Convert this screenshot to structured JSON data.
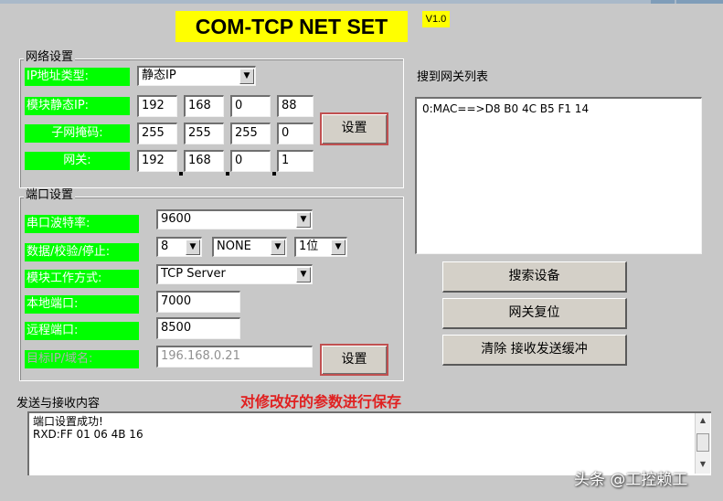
{
  "header": {
    "title": "COM-TCP NET SET",
    "version": "V1.0"
  },
  "network": {
    "group_label": "网络设置",
    "ip_type_label": "IP地址类型:",
    "ip_type_value": "静态IP",
    "static_ip_label": "模块静态IP:",
    "static_ip": [
      "192",
      "168",
      "0",
      "88"
    ],
    "subnet_label": "子网掩码:",
    "subnet": [
      "255",
      "255",
      "255",
      "0"
    ],
    "gateway_label": "网关:",
    "gateway": [
      "192",
      "168",
      "0",
      "1"
    ],
    "set_button": "设置"
  },
  "port": {
    "group_label": "端口设置",
    "baud_label": "串口波特率:",
    "baud_value": "9600",
    "data_label": "数据/校验/停止:",
    "data_bits": "8",
    "parity": "NONE",
    "stop_bits": "1位",
    "mode_label": "模块工作方式:",
    "mode_value": "TCP Server",
    "local_port_label": "本地端口:",
    "local_port": "7000",
    "remote_port_label": "远程端口:",
    "remote_port": "8500",
    "target_label": "目标IP/域名:",
    "target_value": "196.168.0.21",
    "set_button": "设置"
  },
  "gateway_list": {
    "label": "搜到网关列表",
    "items": [
      "0:MAC==>D8 B0 4C B5 F1 14"
    ]
  },
  "actions": {
    "search": "搜索设备",
    "reset": "网关复位",
    "clear": "清除 接收发送缓冲"
  },
  "log": {
    "label": "发送与接收内容",
    "annotation": "对修改好的参数进行保存",
    "lines": [
      "端口设置成功!",
      "RXD:FF 01 06 4B 16"
    ]
  },
  "watermark": "头条 @工控赖工",
  "colors": {
    "label_bg": "#00ff00",
    "title_bg": "#ffff00",
    "annotation": "#e02020",
    "window_bg": "#c8c8c8"
  }
}
